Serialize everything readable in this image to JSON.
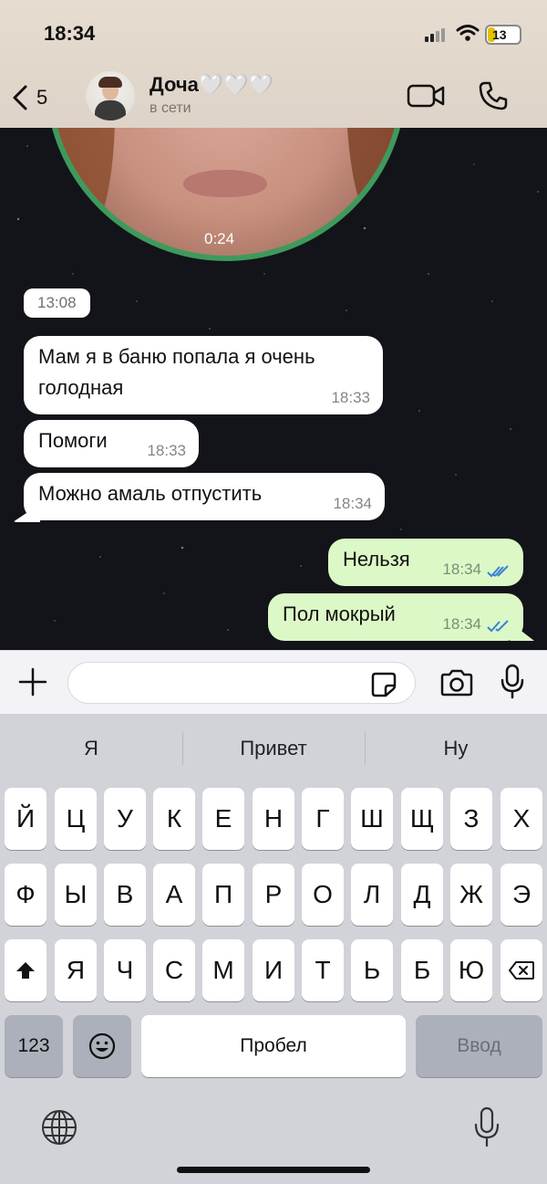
{
  "status_bar": {
    "time": "18:34",
    "battery": "13"
  },
  "header": {
    "back_count": "5",
    "contact_name": "Доча🤍🤍🤍",
    "contact_status": "в сети"
  },
  "video_message": {
    "duration": "0:24"
  },
  "date_pill": "13:08",
  "messages": [
    {
      "direction": "in",
      "text": "Мам я в баню попала я очень голодная",
      "time": "18:33"
    },
    {
      "direction": "in",
      "text": "Помоги",
      "time": "18:33"
    },
    {
      "direction": "in",
      "text": "Можно амаль отпустить",
      "time": "18:34"
    },
    {
      "direction": "out",
      "text": "Нельзя",
      "time": "18:34",
      "read": true
    },
    {
      "direction": "out",
      "text": "Пол мокрый",
      "time": "18:34",
      "read": true
    }
  ],
  "input": {
    "value": "",
    "placeholder": ""
  },
  "keyboard": {
    "suggestions": [
      "Я",
      "Привет",
      "Ну"
    ],
    "row1": [
      "Й",
      "Ц",
      "У",
      "К",
      "Е",
      "Н",
      "Г",
      "Ш",
      "Щ",
      "З",
      "Х"
    ],
    "row2": [
      "Ф",
      "Ы",
      "В",
      "А",
      "П",
      "Р",
      "О",
      "Л",
      "Д",
      "Ж",
      "Э"
    ],
    "row3": [
      "Я",
      "Ч",
      "С",
      "М",
      "И",
      "Т",
      "Ь",
      "Б",
      "Ю"
    ],
    "numbers_label": "123",
    "space_label": "Пробел",
    "enter_label": "Ввод"
  },
  "colors": {
    "outgoing_bubble": "#dcf8c6",
    "incoming_bubble": "#ffffff",
    "read_ticks": "#3b82d6",
    "video_ring": "#3e9a5c"
  }
}
